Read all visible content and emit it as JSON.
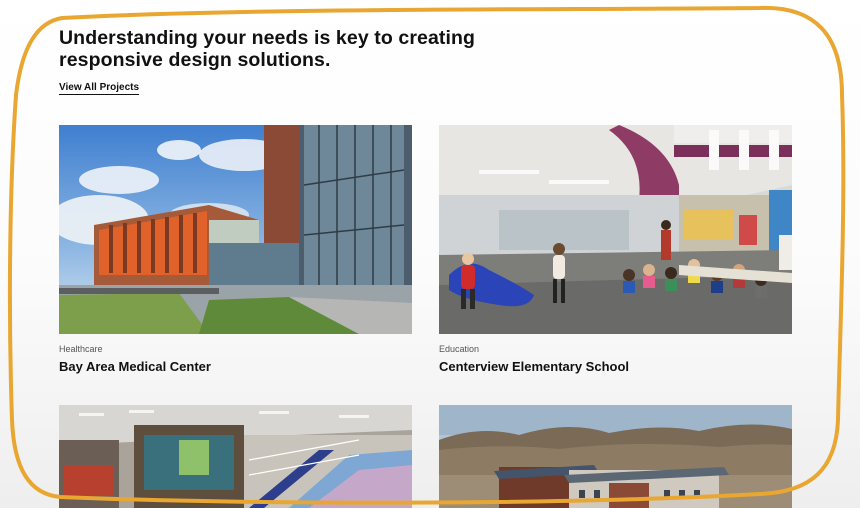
{
  "header": {
    "headline": "Understanding your needs is key to creating responsive design solutions.",
    "view_all_label": "View All Projects"
  },
  "projects": [
    {
      "category": "Healthcare",
      "title": "Bay Area Medical Center"
    },
    {
      "category": "Education",
      "title": "Centerview Elementary School"
    },
    {
      "category": "",
      "title": ""
    },
    {
      "category": "",
      "title": ""
    }
  ],
  "colors": {
    "annotation_outline": "#e9a631",
    "text": "#111111",
    "category_text": "#555555"
  }
}
